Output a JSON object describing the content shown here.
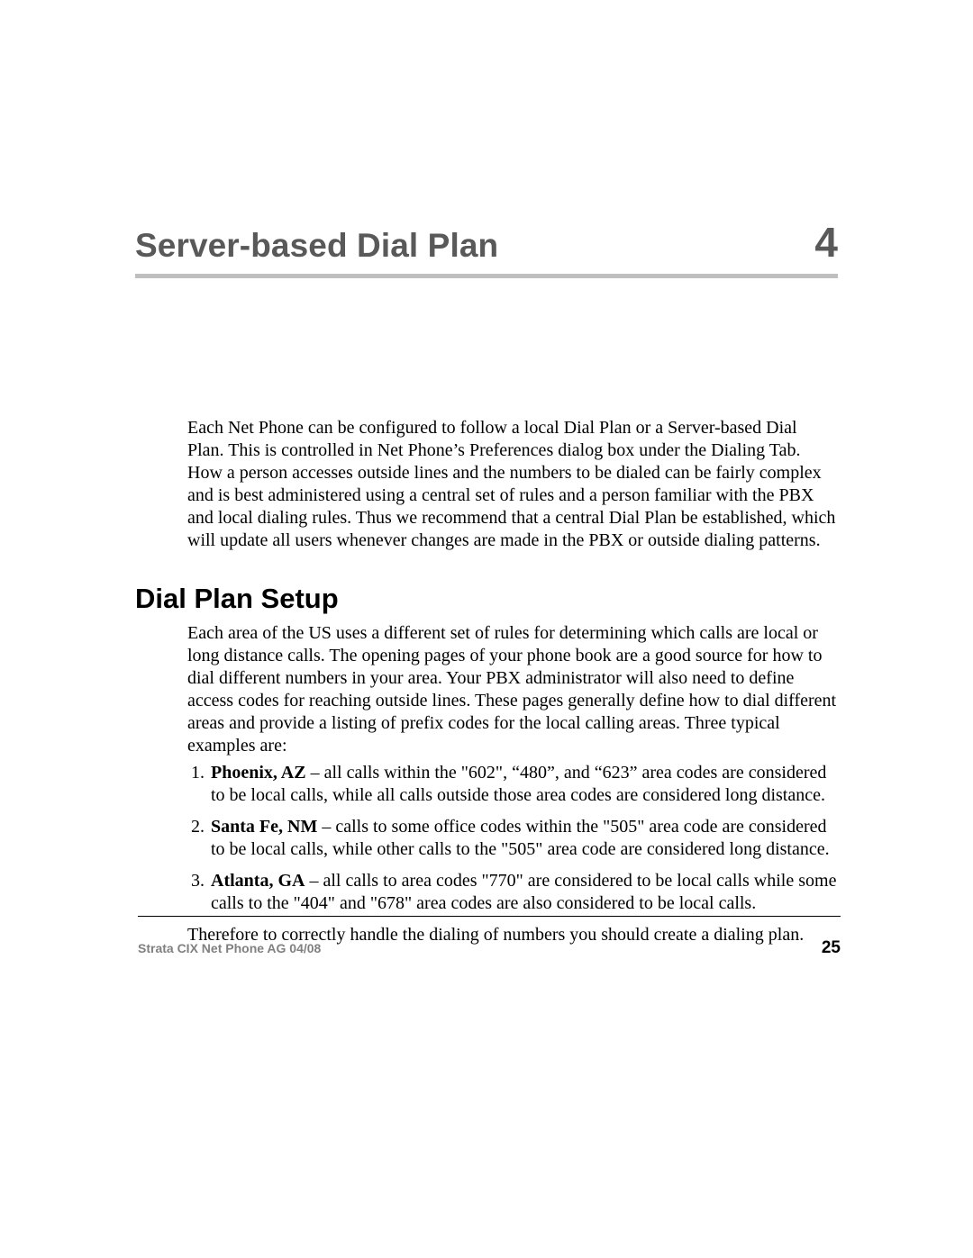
{
  "chapter": {
    "title": "Server-based Dial Plan",
    "number": "4"
  },
  "intro": "Each Net Phone can be configured to follow a local Dial Plan or a Server-based Dial Plan. This is controlled in Net Phone’s Preferences dialog box under the Dialing Tab. How a person accesses outside lines and the numbers to be dialed can be fairly complex and is best administered using a central set of rules and a person familiar with the PBX and local dialing rules. Thus we recommend that a central Dial Plan be established, which will update all users whenever changes are made in the PBX or outside dialing patterns.",
  "section": {
    "title": "Dial Plan Setup",
    "lead": "Each area of the US uses a different set of rules for determining which calls are local or long distance calls. The opening pages of your phone book are a good source for how to dial different numbers in your area. Your PBX administrator will also need to define access codes for reaching outside lines.   These pages generally define how to dial different areas and provide a listing of prefix codes for the local calling areas. Three typical examples are:",
    "items": [
      {
        "place": "Phoenix, AZ",
        "text": " – all calls within the \"602\", “480”, and “623” area codes are considered to be local calls, while all calls outside those area codes are considered long distance."
      },
      {
        "place": "Santa Fe, NM",
        "text": " – calls to some office codes within the \"505\" area code are considered to be local calls, while other calls to the \"505\" area code are considered long distance."
      },
      {
        "place": "Atlanta, GA",
        "text": " – all calls to area codes \"770\" are considered to be local calls while some calls to the \"404\" and \"678\" area codes are also considered to be local calls."
      }
    ],
    "closing": "Therefore to correctly handle the dialing of numbers you should create a dialing plan."
  },
  "footer": {
    "doc": "Strata CIX Net Phone AG    04/08",
    "page": "25"
  }
}
